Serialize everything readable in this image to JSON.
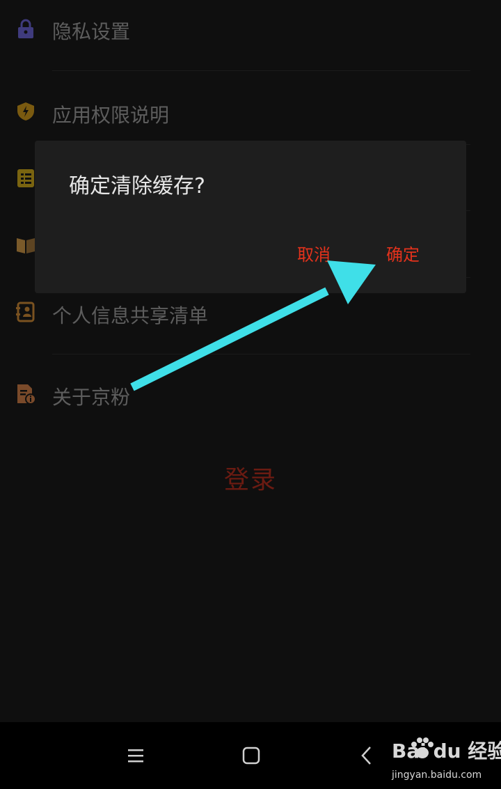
{
  "settings": {
    "items": [
      {
        "label": "隐私设置",
        "icon": "lock-icon",
        "color": "#3f3b7d"
      },
      {
        "label": "应用权限说明",
        "icon": "shield-icon",
        "color": "#7a5a10"
      },
      {
        "label": "",
        "icon": "list-icon",
        "color": "#7a6410"
      },
      {
        "label": "",
        "icon": "book-icon",
        "color": "#7a5a2a"
      },
      {
        "label": "个人信息共享清单",
        "icon": "contact-card-icon",
        "color": "#7a5220"
      },
      {
        "label": "关于京粉",
        "icon": "document-info-icon",
        "color": "#7a4a2a"
      }
    ],
    "login_label": "登录"
  },
  "dialog": {
    "title": "确定清除缓存?",
    "cancel_label": "取消",
    "confirm_label": "确定",
    "button_color": "#e3321c"
  },
  "navbar": {
    "buttons": [
      "menu-icon",
      "home-icon",
      "back-icon"
    ]
  },
  "watermark": {
    "brand": "Bai du 经验",
    "url": "jingyan.baidu.com"
  },
  "annotation": {
    "arrow_color": "#3fdfe8"
  }
}
